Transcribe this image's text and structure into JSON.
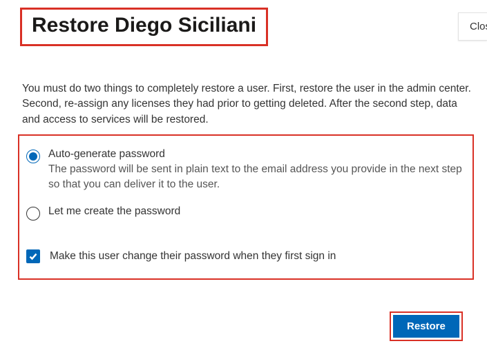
{
  "title": "Restore Diego Siciliani",
  "close_label": "Close",
  "description": "You must do two things to completely restore a user. First, restore the user in the admin center. Second, re-assign any licenses they had prior to getting deleted. After the second step, data and access to services will be restored.",
  "options": {
    "auto": {
      "label": "Auto-generate password",
      "description": "The password will be sent in plain text to the email address you provide in the next step so that you can deliver it to the user."
    },
    "manual": {
      "label": "Let me create the password"
    }
  },
  "checkbox_label": "Make this user change their password when they first sign in",
  "restore_label": "Restore"
}
